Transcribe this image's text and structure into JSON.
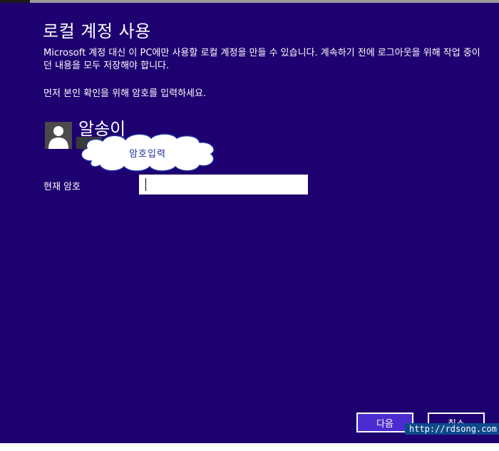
{
  "dialog": {
    "title": "로컬 계정 사용",
    "description": "Microsoft 계정 대신 이 PC에만 사용할 로컬 계정을 만들 수 있습니다. 계속하기 전에 로그아웃을 위해 작업 중이던 내용을 모두 저장해야 합니다.",
    "prompt": "먼저 본인 확인을 위해 암호를 입력하세요."
  },
  "user": {
    "name": "알송이",
    "avatar_icon": "user-silhouette-icon"
  },
  "annotation": {
    "text": "암호입력",
    "color": "#1e2fa0"
  },
  "password": {
    "label": "현재 암호",
    "value": ""
  },
  "buttons": {
    "next": "다음",
    "cancel": "취소"
  },
  "watermark": "http://rdsong.com",
  "colors": {
    "background": "#1e0070",
    "accent": "#4c2bd0"
  }
}
